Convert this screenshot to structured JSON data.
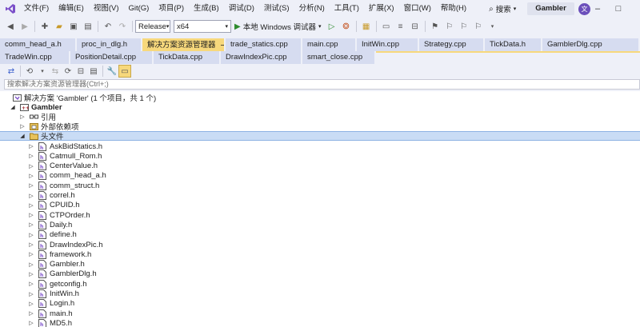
{
  "menubar": {
    "items": [
      "文件(F)",
      "编辑(E)",
      "视图(V)",
      "Git(G)",
      "项目(P)",
      "生成(B)",
      "调试(D)",
      "测试(S)",
      "分析(N)",
      "工具(T)",
      "扩展(X)",
      "窗口(W)",
      "帮助(H)"
    ],
    "search_label": "搜索",
    "solution_name": "Gambler",
    "avatar_text": "文"
  },
  "toolbar": {
    "config": "Release",
    "platform": "x64",
    "run_label": "本地 Windows 调试器"
  },
  "tabs_row1": [
    {
      "label": "comm_head_a.h",
      "active": false
    },
    {
      "label": "proc_in_dlg.h",
      "active": false
    },
    {
      "label": "解决方案资源管理器",
      "active": true
    },
    {
      "label": "trade_statics.cpp",
      "active": false
    },
    {
      "label": "main.cpp",
      "active": false
    },
    {
      "label": "InitWin.cpp",
      "active": false
    },
    {
      "label": "Strategy.cpp",
      "active": false
    },
    {
      "label": "TickData.h",
      "active": false
    },
    {
      "label": "GamblerDlg.cpp",
      "active": false
    }
  ],
  "tabs_row2": [
    {
      "label": "TradeWin.cpp"
    },
    {
      "label": "PositionDetail.cpp"
    },
    {
      "label": "TickData.cpp"
    },
    {
      "label": "DrawIndexPic.cpp"
    },
    {
      "label": "smart_close.cpp"
    }
  ],
  "solution_explorer": {
    "search_placeholder": "搜索解决方案资源管理器(Ctrl+;)",
    "solution_label": "解决方案 'Gambler' (1 个项目，共 1 个)",
    "project_label": "Gambler",
    "references_label": "引用",
    "external_deps_label": "外部依赖项",
    "header_files_label": "头文件",
    "header_files": [
      "AskBidStatics.h",
      "Catmull_Rom.h",
      "CenterValue.h",
      "comm_head_a.h",
      "comm_struct.h",
      "correl.h",
      "CPUID.h",
      "CTPOrder.h",
      "Daily.h",
      "define.h",
      "DrawIndexPic.h",
      "framework.h",
      "Gambler.h",
      "GamblerDlg.h",
      "getconfig.h",
      "InitWin.h",
      "Login.h",
      "main.h",
      "MD5.h"
    ]
  }
}
